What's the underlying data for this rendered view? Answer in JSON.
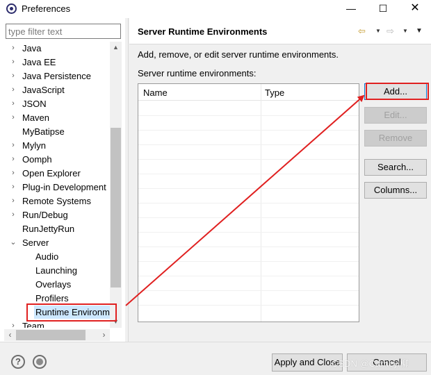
{
  "window": {
    "title": "Preferences",
    "minimize": "—",
    "maximize": "☐",
    "close": "✕"
  },
  "filter": {
    "placeholder": "type filter text"
  },
  "tree": {
    "items": [
      {
        "label": "Java",
        "arrow": "›"
      },
      {
        "label": "Java EE",
        "arrow": "›"
      },
      {
        "label": "Java Persistence",
        "arrow": "›"
      },
      {
        "label": "JavaScript",
        "arrow": "›"
      },
      {
        "label": "JSON",
        "arrow": "›"
      },
      {
        "label": "Maven",
        "arrow": "›"
      },
      {
        "label": "MyBatipse",
        "arrow": ""
      },
      {
        "label": "Mylyn",
        "arrow": "›"
      },
      {
        "label": "Oomph",
        "arrow": "›"
      },
      {
        "label": "Open Explorer",
        "arrow": "›"
      },
      {
        "label": "Plug-in Development",
        "arrow": "›"
      },
      {
        "label": "Remote Systems",
        "arrow": "›"
      },
      {
        "label": "Run/Debug",
        "arrow": "›"
      },
      {
        "label": "RunJettyRun",
        "arrow": ""
      },
      {
        "label": "Server",
        "arrow": "⌄"
      },
      {
        "label": "Audio",
        "arrow": ""
      },
      {
        "label": "Launching",
        "arrow": ""
      },
      {
        "label": "Overlays",
        "arrow": ""
      },
      {
        "label": "Profilers",
        "arrow": ""
      },
      {
        "label": "Runtime Environm",
        "arrow": ""
      },
      {
        "label": "Team",
        "arrow": "›"
      }
    ]
  },
  "page": {
    "title": "Server Runtime Environments",
    "description": "Add, remove, or edit server runtime environments.",
    "table_label": "Server runtime environments:",
    "columns": {
      "name": "Name",
      "type": "Type"
    }
  },
  "buttons": {
    "add": "Add...",
    "edit": "Edit...",
    "remove": "Remove",
    "search": "Search...",
    "columns": "Columns..."
  },
  "footer": {
    "apply_close": "Apply and Close",
    "cancel": "Cancel",
    "watermark": "CSDN @Carney.柳"
  },
  "icons": {
    "back": "⇦",
    "forward": "⇨",
    "dropdown": "▼",
    "menu": "▼",
    "help": "?",
    "scroll_up": "▲",
    "scroll_down": "▼",
    "scroll_left": "‹",
    "scroll_right": "›"
  },
  "colors": {
    "annotation": "#e02020",
    "selection": "#cde8ff",
    "focus": "#0078d7"
  }
}
